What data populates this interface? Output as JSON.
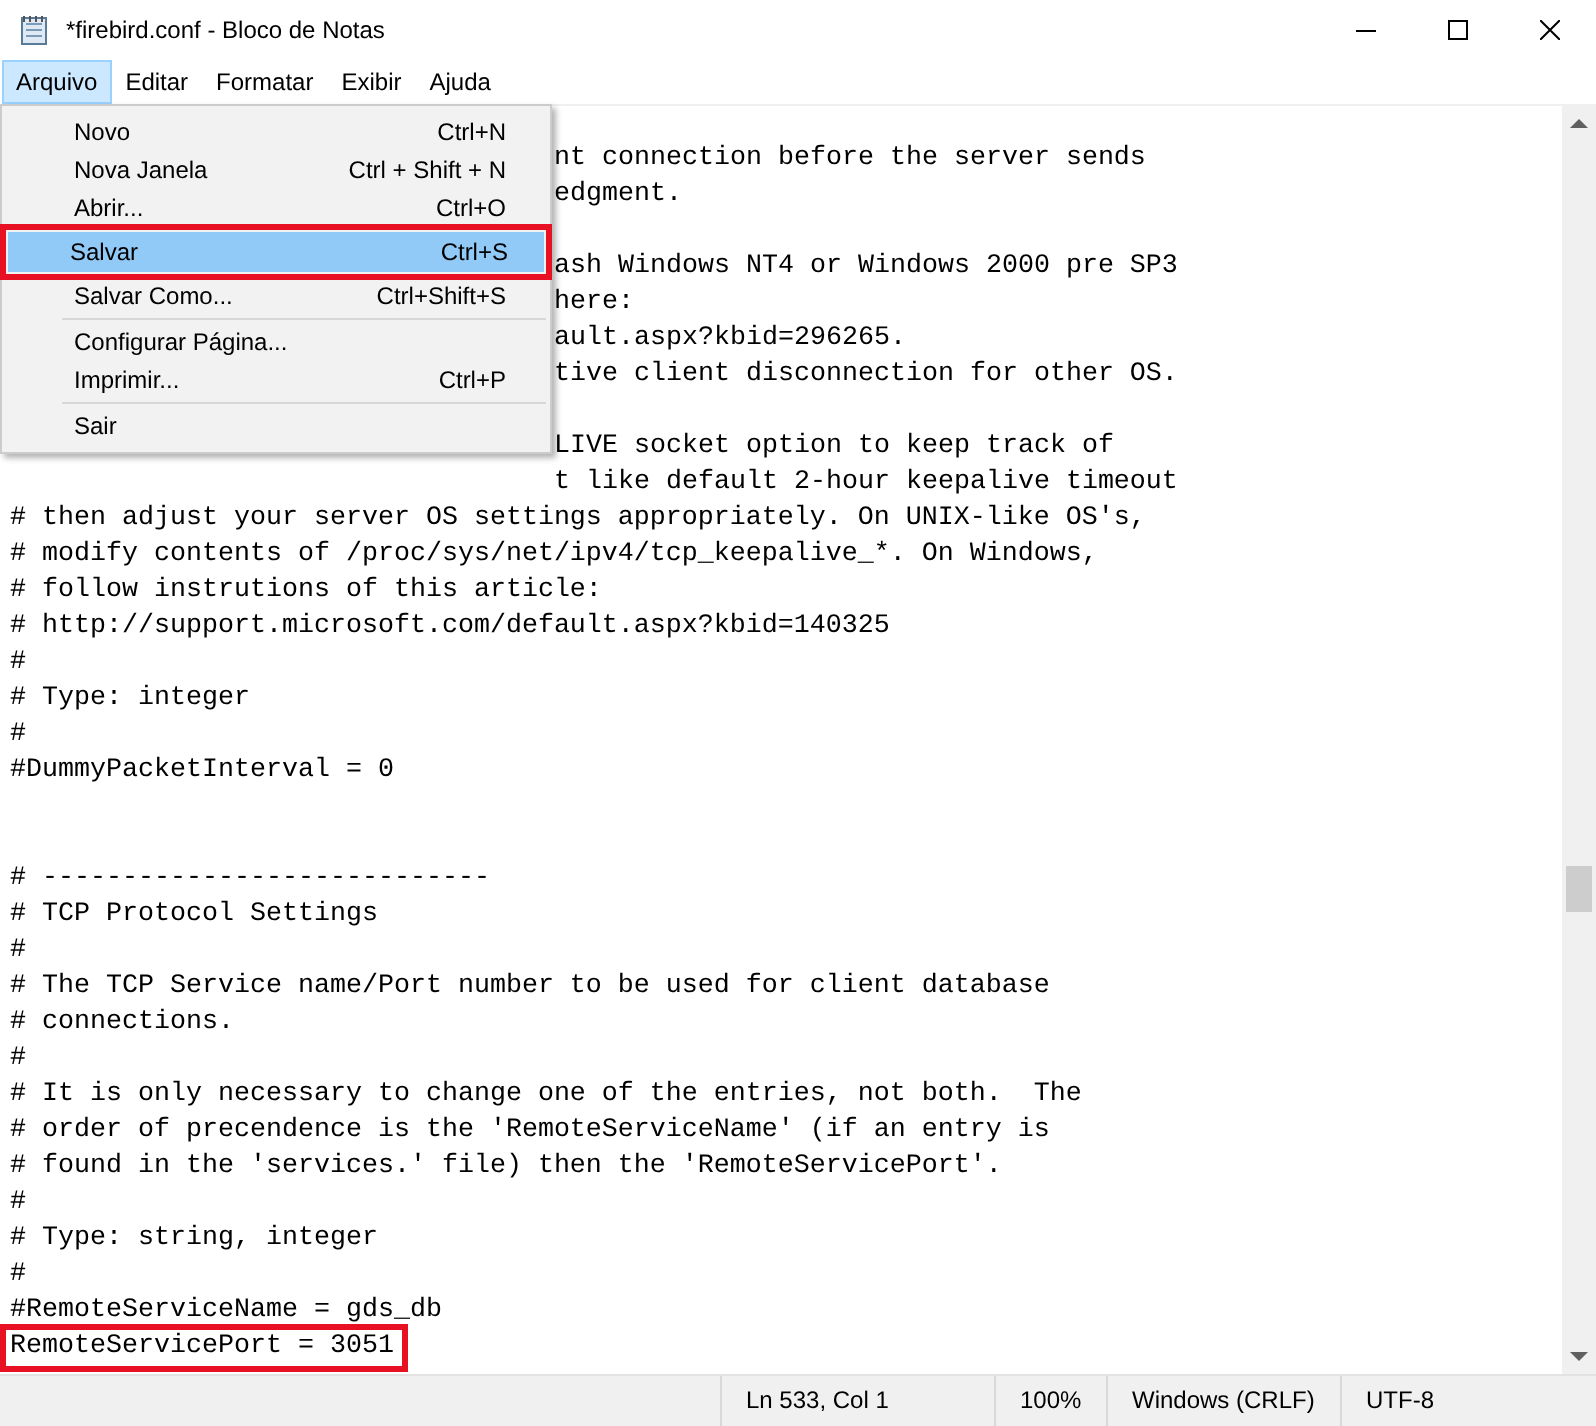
{
  "window": {
    "title": "*firebird.conf - Bloco de Notas"
  },
  "menu_bar": [
    {
      "label": "Arquivo",
      "selected": true
    },
    {
      "label": "Editar",
      "selected": false
    },
    {
      "label": "Formatar",
      "selected": false
    },
    {
      "label": "Exibir",
      "selected": false
    },
    {
      "label": "Ajuda",
      "selected": false
    }
  ],
  "dropdown": [
    {
      "kind": "item",
      "label": "Novo",
      "shortcut": "Ctrl+N",
      "selected": false,
      "marked": false
    },
    {
      "kind": "item",
      "label": "Nova Janela",
      "shortcut": "Ctrl + Shift + N",
      "selected": false,
      "marked": false
    },
    {
      "kind": "item",
      "label": "Abrir...",
      "shortcut": "Ctrl+O",
      "selected": false,
      "marked": false
    },
    {
      "kind": "item",
      "label": "Salvar",
      "shortcut": "Ctrl+S",
      "selected": true,
      "marked": true
    },
    {
      "kind": "item",
      "label": "Salvar Como...",
      "shortcut": "Ctrl+Shift+S",
      "selected": false,
      "marked": false
    },
    {
      "kind": "separator"
    },
    {
      "kind": "item",
      "label": "Configurar Página...",
      "selected": false,
      "marked": false
    },
    {
      "kind": "item",
      "label": "Imprimir...",
      "shortcut": "Ctrl+P",
      "selected": false,
      "marked": false
    },
    {
      "kind": "separator"
    },
    {
      "kind": "item",
      "label": "Sair",
      "selected": false,
      "marked": false
    }
  ],
  "editor_lines": [
    {
      "kind": "blank"
    },
    {
      "kind": "covered",
      "text": "nt connection before the server sends"
    },
    {
      "kind": "covered",
      "text": "edgment."
    },
    {
      "kind": "blank"
    },
    {
      "kind": "covered",
      "text": "ash Windows NT4 or Windows 2000 pre SP3"
    },
    {
      "kind": "covered",
      "text": "here:"
    },
    {
      "kind": "covered",
      "text": "ault.aspx?kbid=296265."
    },
    {
      "kind": "covered",
      "text": "tive client disconnection for other OS."
    },
    {
      "kind": "blank"
    },
    {
      "kind": "covered",
      "text": "LIVE socket option to keep track of"
    },
    {
      "kind": "covered",
      "text": "t like default 2-hour keepalive timeout"
    },
    {
      "kind": "text",
      "text": "# then adjust your server OS settings appropriately. On UNIX-like OS's,"
    },
    {
      "kind": "text",
      "text": "# modify contents of /proc/sys/net/ipv4/tcp_keepalive_*. On Windows,"
    },
    {
      "kind": "text",
      "text": "# follow instrutions of this article:"
    },
    {
      "kind": "text",
      "text": "# http://support.microsoft.com/default.aspx?kbid=140325"
    },
    {
      "kind": "text",
      "text": "#"
    },
    {
      "kind": "text",
      "text": "# Type: integer"
    },
    {
      "kind": "text",
      "text": "#"
    },
    {
      "kind": "text",
      "text": "#DummyPacketInterval = 0"
    },
    {
      "kind": "blank"
    },
    {
      "kind": "blank"
    },
    {
      "kind": "text",
      "text": "# ----------------------------"
    },
    {
      "kind": "text",
      "text": "# TCP Protocol Settings"
    },
    {
      "kind": "text",
      "text": "#"
    },
    {
      "kind": "text",
      "text": "# The TCP Service name/Port number to be used for client database"
    },
    {
      "kind": "text",
      "text": "# connections."
    },
    {
      "kind": "text",
      "text": "#"
    },
    {
      "kind": "text",
      "text": "# It is only necessary to change one of the entries, not both.  The"
    },
    {
      "kind": "text",
      "text": "# order of precendence is the 'RemoteServiceName' (if an entry is"
    },
    {
      "kind": "text",
      "text": "# found in the 'services.' file) then the 'RemoteServicePort'."
    },
    {
      "kind": "text",
      "text": "#"
    },
    {
      "kind": "text",
      "text": "# Type: string, integer"
    },
    {
      "kind": "text",
      "text": "#"
    },
    {
      "kind": "text",
      "text": "#RemoteServiceName = gds_db"
    },
    {
      "kind": "marked",
      "text": "RemoteServicePort = 3051"
    }
  ],
  "status_bar": [
    "Ln 533, Col 1",
    "100%",
    "Windows (CRLF)",
    "UTF-8"
  ]
}
